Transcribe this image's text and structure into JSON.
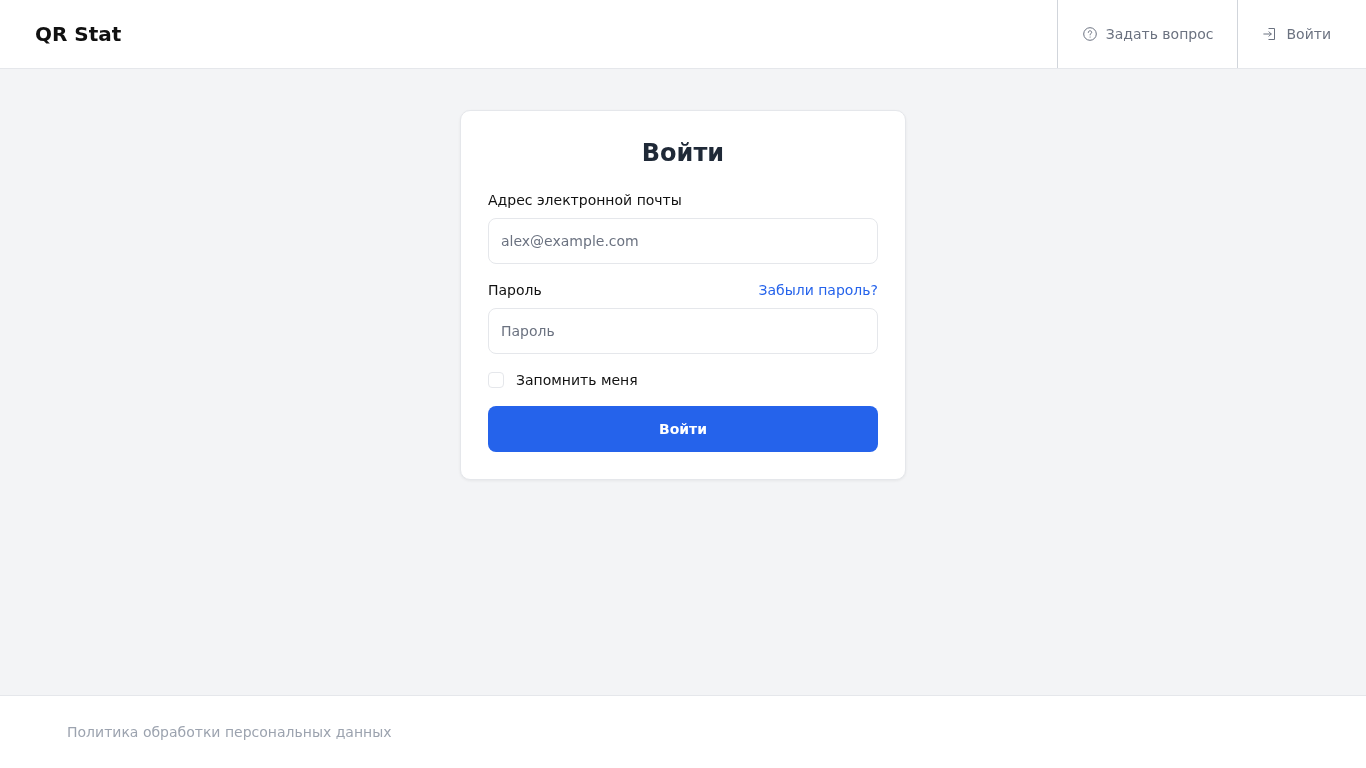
{
  "header": {
    "logo": "QR Stat",
    "nav": [
      {
        "kind": "help",
        "label": "Задать вопрос"
      },
      {
        "kind": "login",
        "label": "Войти"
      }
    ]
  },
  "login_form": {
    "title": "Войти",
    "email": {
      "label": "Адрес электронной почты",
      "placeholder": "alex@example.com"
    },
    "password": {
      "label": "Пароль",
      "placeholder": "Пароль",
      "forgot_link": "Забыли пароль?"
    },
    "remember": {
      "label": "Запомнить меня",
      "checked": false
    },
    "submit": "Войти"
  },
  "footer": {
    "link": "Политика обработки персональных данных"
  }
}
